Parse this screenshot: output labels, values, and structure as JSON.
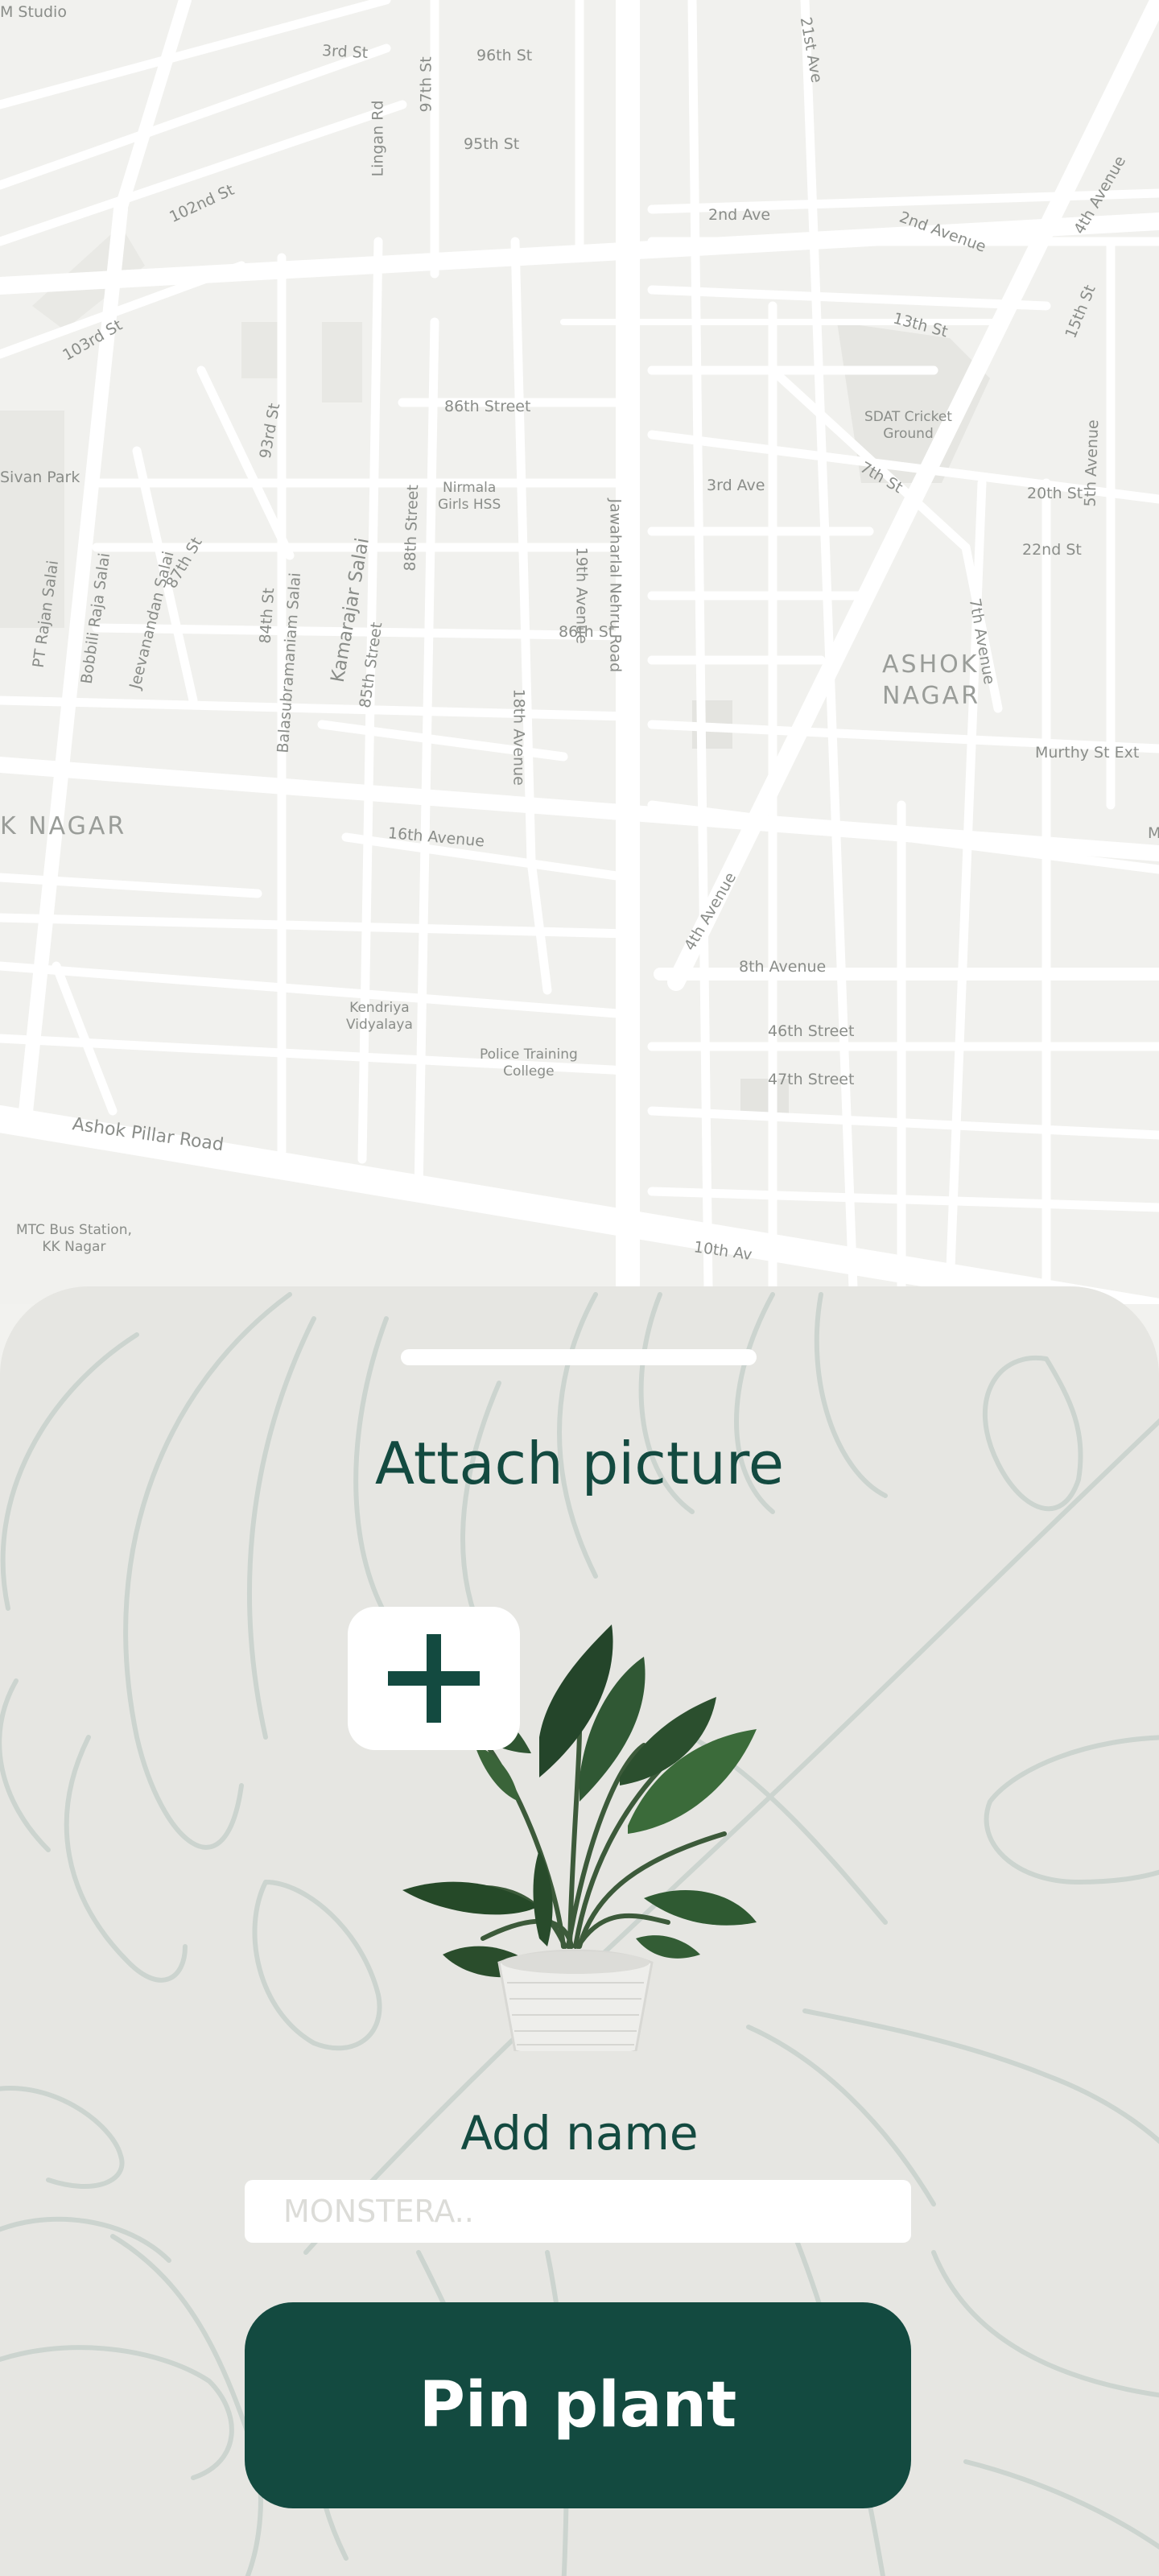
{
  "colors": {
    "accent": "#134a40",
    "sheet_background": "#e6e6e2",
    "map_background": "#f1f1ee",
    "road": "#ffffff",
    "label": "#8a8d89"
  },
  "map": {
    "street_labels": [
      "M Studio",
      "3rd St",
      "96th St",
      "95th St",
      "Lingan Rd",
      "97th St",
      "21st Ave",
      "102nd St",
      "2nd Ave",
      "2nd Avenue",
      "4th Avenue",
      "13th St",
      "15th St",
      "103rd St",
      "86th Street",
      "93rd St",
      "SDAT Cricket\nGround",
      "5th Avenue",
      "Sivan Park",
      "Nirmala\nGirls HSS",
      "3rd Ave",
      "7th St",
      "20th St",
      "22nd St",
      "88th Street",
      "19th Avenue",
      "Jawaharlal Nehru Road",
      "PT Rajan Salai",
      "Bobbili Raja Salai",
      "Jeevanandan Salai",
      "87th St",
      "84th St",
      "Balasubramaniam Salai",
      "Kamarajar Salai",
      "85th Street",
      "86th St",
      "18th Avenue",
      "7th Avenue",
      "Murthy St Ext",
      "16th Avenue",
      "4th Avenue",
      "8th Avenue",
      "Kendriya\nVidyalaya",
      "46th Street",
      "Police Training\nCollege",
      "47th Street",
      "Ashok Pillar Road",
      "MTC Bus Station,\nKK Nagar",
      "10th Av",
      "M"
    ],
    "area_labels": [
      "ASHOK\nNAGAR",
      "K NAGAR"
    ]
  },
  "sheet": {
    "title": "Attach picture",
    "attach_icon": "plus-icon",
    "photo_subject": "potted-plant-photo",
    "name_label": "Add name",
    "name_input": {
      "value": "",
      "placeholder": "MONSTERA.."
    },
    "submit_label": "Pin plant"
  }
}
